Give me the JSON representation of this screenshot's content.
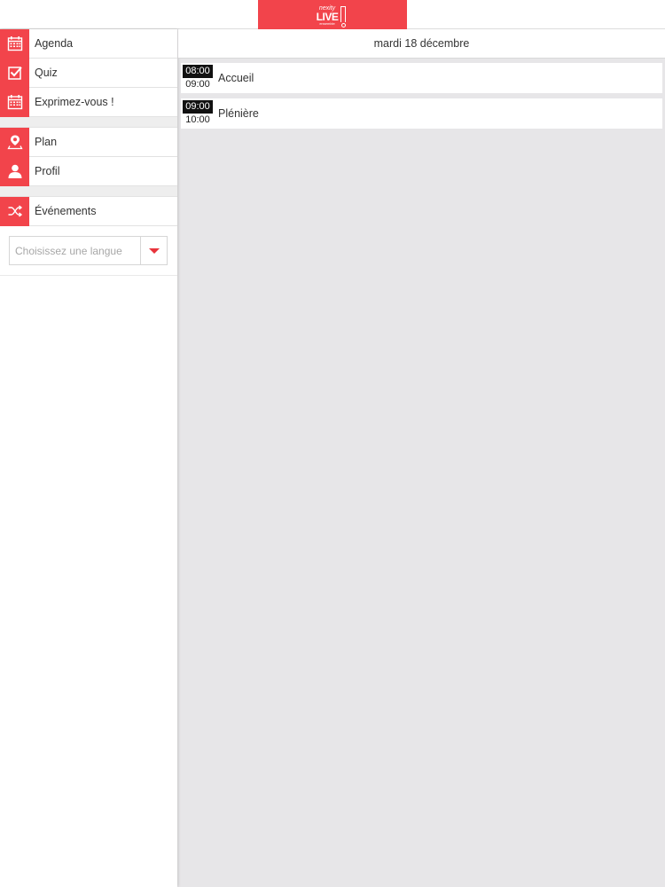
{
  "header": {
    "logo_top": "nexity",
    "logo_main": "LIVE",
    "logo_bottom": "ensemble"
  },
  "nav": {
    "group1": [
      {
        "label": "Agenda",
        "icon": "calendar-icon"
      },
      {
        "label": "Quiz",
        "icon": "checkbox-icon"
      },
      {
        "label": "Exprimez-vous !",
        "icon": "calendar-icon"
      }
    ],
    "group2": [
      {
        "label": "Plan",
        "icon": "map-pin-icon"
      },
      {
        "label": "Profil",
        "icon": "user-icon"
      }
    ],
    "group3": [
      {
        "label": "Événements",
        "icon": "shuffle-icon"
      }
    ]
  },
  "language": {
    "placeholder": "Choisissez une langue"
  },
  "agenda": {
    "date": "mardi 18 décembre",
    "sessions": [
      {
        "start": "08:00",
        "end": "09:00",
        "title": "Accueil"
      },
      {
        "start": "09:00",
        "end": "10:00",
        "title": "Plénière"
      }
    ]
  },
  "colors": {
    "accent": "#f2444b",
    "background": "#e7e6e8"
  }
}
